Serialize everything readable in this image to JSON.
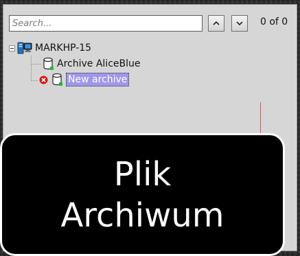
{
  "search": {
    "placeholder": "Search...",
    "value": "",
    "result_count": "0 of 0"
  },
  "toolbar": {
    "prev_icon": "chevron-up-icon",
    "next_icon": "chevron-down-icon"
  },
  "tree": {
    "root": {
      "label": "MARKHP-15",
      "icon": "server-icon",
      "expanded": true
    },
    "children": [
      {
        "label": "Archive AliceBlue",
        "icon": "archive-icon",
        "status": "ok",
        "selected": false
      },
      {
        "label": "New archive",
        "icon": "archive-icon",
        "status": "error",
        "selected": true
      }
    ]
  },
  "caption": {
    "line1": "Plik",
    "line2": "Archiwum"
  },
  "colors": {
    "panel_background": "#d6d6d6",
    "selection": "#9f98e8",
    "error": "#d11a1a",
    "archive_indicator": "#2db52d",
    "caption_background": "#000000",
    "caption_text": "#ffffff"
  }
}
